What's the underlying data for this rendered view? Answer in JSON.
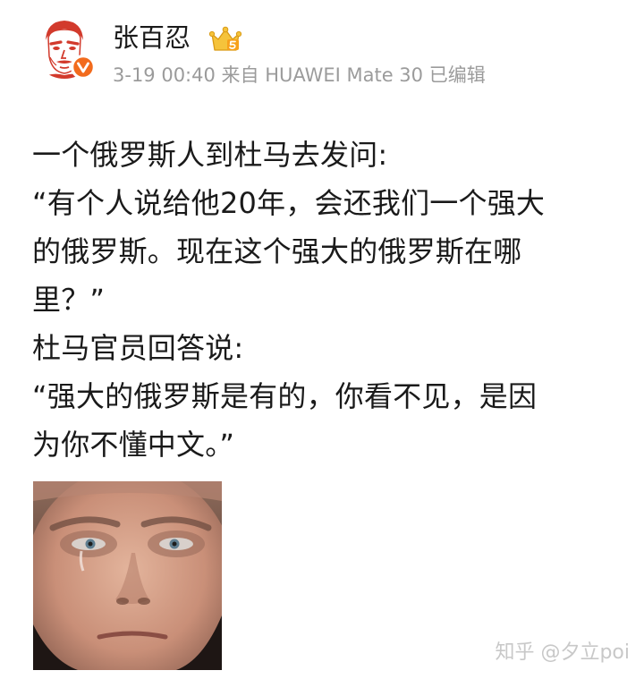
{
  "post": {
    "author": "张百忍",
    "meta": "3-19 00:40 来自 HUAWEI Mate 30 已编辑",
    "lines": [
      "一个俄罗斯人到杜马去发问:",
      "“有个人说给他20年，会还我们一个强大",
      "的俄罗斯。现在这个强大的俄罗斯在哪",
      "里？”",
      "杜马官员回答说:",
      "“强大的俄罗斯是有的，你看不见，是因",
      "为你不懂中文。”"
    ]
  },
  "watermark": "知乎 @夕立poi",
  "colors": {
    "text": "#1a1a1a",
    "meta": "#9b9b9b",
    "verified": "#f26b1d",
    "vip_gold": "#f5c33b",
    "watermark": "#c8c8c8"
  },
  "icons": {
    "avatar": "avatar",
    "verified": "verified-badge-icon",
    "vip": "vip-crown-icon"
  }
}
